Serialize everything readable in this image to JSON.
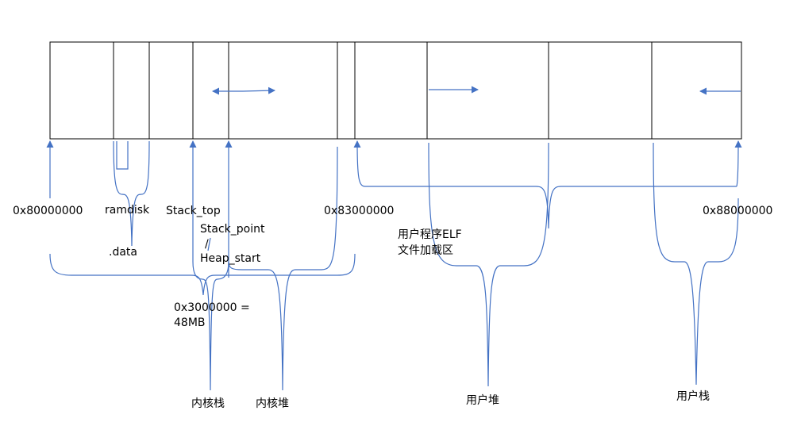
{
  "colors": {
    "box_stroke": "#000000",
    "line": "#4472C4",
    "text": "#000000",
    "background": "#ffffff"
  },
  "labels": {
    "addr_start": "0x80000000",
    "ramdisk": "ramdisk",
    "data": ".data",
    "stack_top": "Stack_top",
    "stack_point": "Stack_point",
    "slash": "/",
    "heap_start": "Heap_start",
    "size_line1": "0x3000000 =",
    "size_line2": "48MB",
    "addr_mid": "0x83000000",
    "user_elf_line1": "用户程序ELF",
    "user_elf_line2": "文件加载区",
    "addr_end": "0x88000000",
    "kernel_stack": "内核栈",
    "kernel_heap": "内核堆",
    "user_heap": "用户堆",
    "user_stack": "用户栈"
  }
}
